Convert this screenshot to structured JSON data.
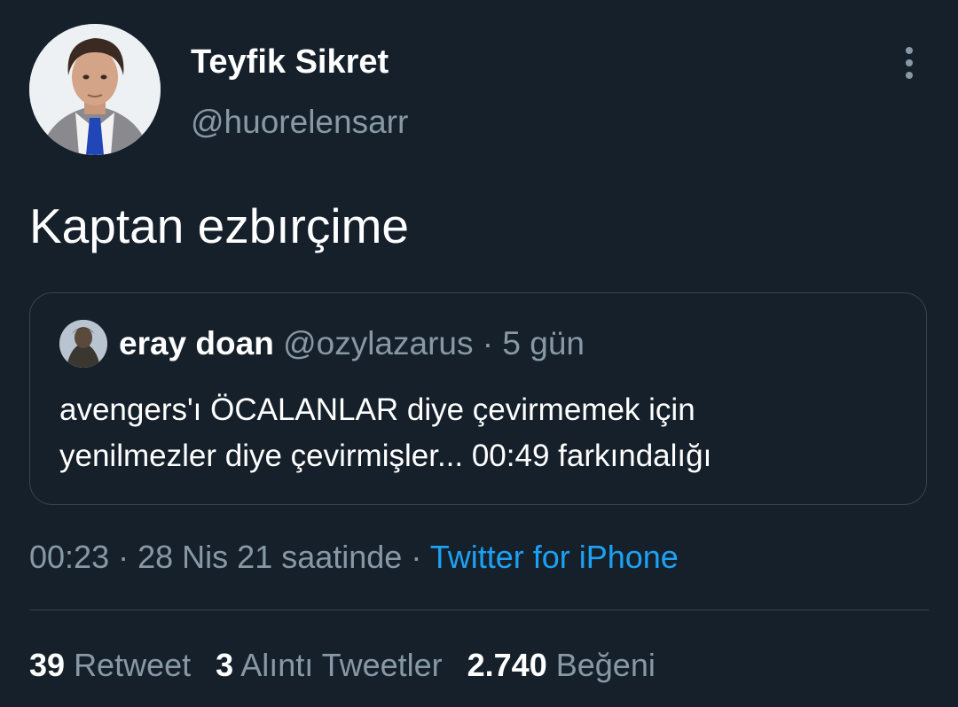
{
  "author": {
    "display_name": "Teyfik Sikret",
    "handle": "@huorelensarr"
  },
  "tweet": {
    "text": "Kaptan ezbırçime"
  },
  "quoted_tweet": {
    "author_name": "eray doan",
    "handle": "@ozylazarus",
    "separator": "·",
    "age": "5 gün",
    "text_line_1": "avengers'ı ÖCALANLAR diye çevirmemek için",
    "text_line_2": "yenilmezler diye çevirmişler... 00:49 farkındalığı"
  },
  "meta": {
    "time": "00:23",
    "separator": "·",
    "date": "28 Nis 21 saatinde",
    "source": "Twitter for iPhone"
  },
  "stats": {
    "retweets_count": "39",
    "retweets_label": "Retweet",
    "quotes_count": "3",
    "quotes_label": "Alıntı Tweetler",
    "likes_count": "2.740",
    "likes_label": "Beğeni"
  },
  "icons": {
    "more": "more-vertical-icon"
  },
  "colors": {
    "background": "#15202b",
    "secondary_text": "#8899a6",
    "link": "#1da1f2",
    "border": "#38444d"
  }
}
